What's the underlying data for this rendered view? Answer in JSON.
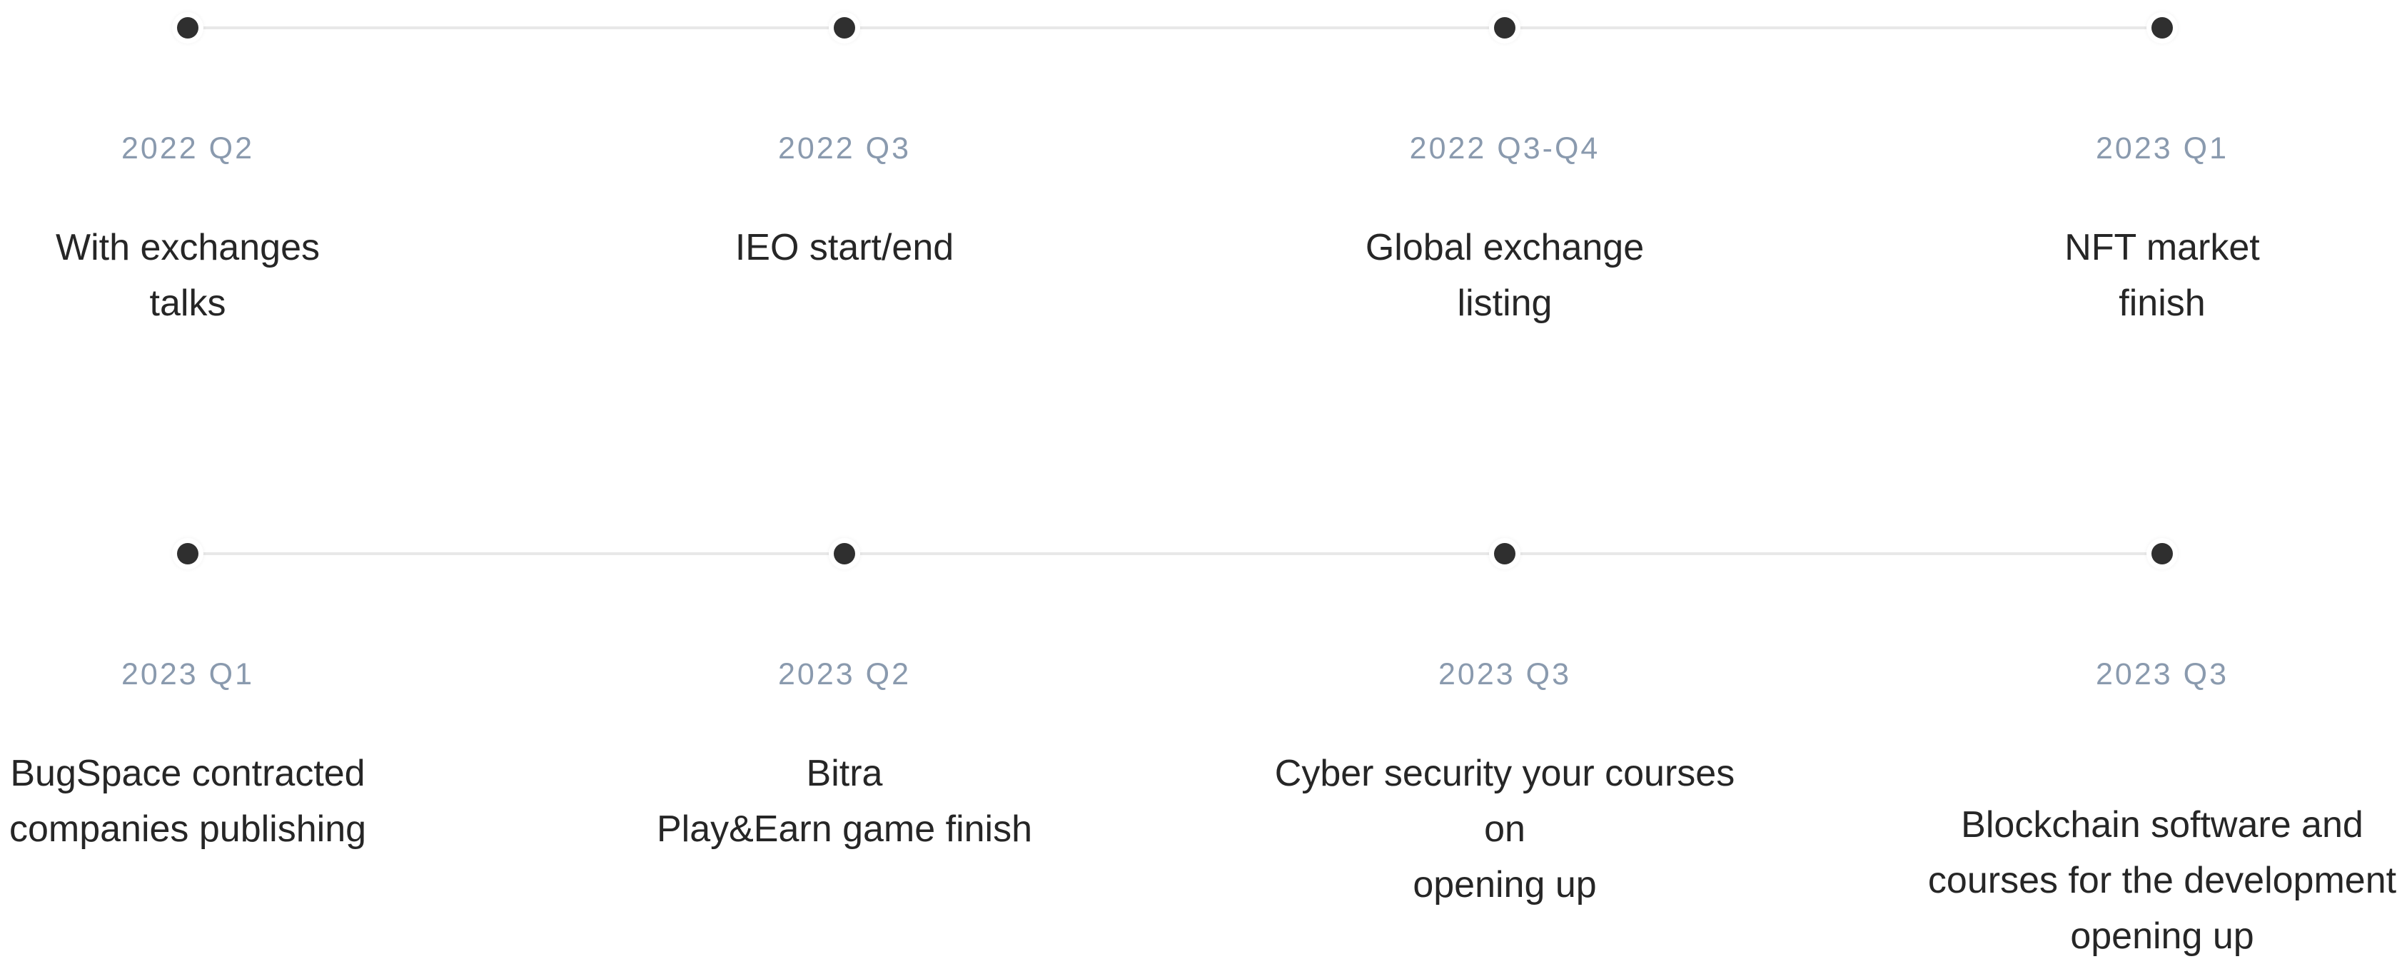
{
  "rows": [
    {
      "milestones": [
        {
          "date": "2022 Q2",
          "description": "With exchanges\ntalks"
        },
        {
          "date": "2022 Q3",
          "description": "IEO start/end"
        },
        {
          "date": "2022 Q3-Q4",
          "description": "Global exchange\nlisting"
        },
        {
          "date": "2023 Q1",
          "description": "NFT market\nfinish"
        }
      ]
    },
    {
      "milestones": [
        {
          "date": "2023 Q1",
          "description": "BugSpace contracted\ncompanies publishing"
        },
        {
          "date": "2023 Q2",
          "description": "Bitra\nPlay&Earn game finish"
        },
        {
          "date": "2023 Q3",
          "description": "Cyber security your courses on\nopening up"
        },
        {
          "date": "2023 Q3",
          "description": "Blockchain software and\ncourses for the development\nopening up"
        }
      ]
    }
  ],
  "colors": {
    "dot": "#2f2f2f",
    "track": "#e8e8e8",
    "date_text": "#8a9aae",
    "description_text": "#262626"
  }
}
